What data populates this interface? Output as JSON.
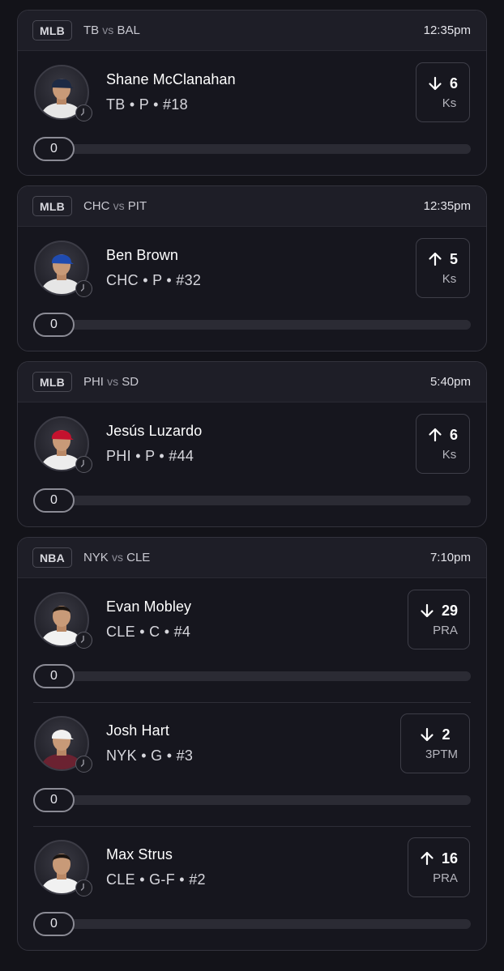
{
  "games": [
    {
      "league": "MLB",
      "home": "TB",
      "vs": "vs",
      "away": "BAL",
      "time": "12:35pm",
      "picks": [
        {
          "name": "Shane McClanahan",
          "meta": "TB • P • #18",
          "direction": "down",
          "line": "6",
          "stat": "Ks",
          "progress": "0",
          "cap_color": "#1d2a44",
          "jersey_color": "#e6e6e6"
        }
      ]
    },
    {
      "league": "MLB",
      "home": "CHC",
      "vs": "vs",
      "away": "PIT",
      "time": "12:35pm",
      "picks": [
        {
          "name": "Ben Brown",
          "meta": "CHC • P • #32",
          "direction": "up",
          "line": "5",
          "stat": "Ks",
          "progress": "0",
          "cap_color": "#1f4bb0",
          "jersey_color": "#e6e6e6"
        }
      ]
    },
    {
      "league": "MLB",
      "home": "PHI",
      "vs": "vs",
      "away": "SD",
      "time": "5:40pm",
      "picks": [
        {
          "name": "Jesús Luzardo",
          "meta": "PHI • P • #44",
          "direction": "up",
          "line": "6",
          "stat": "Ks",
          "progress": "0",
          "cap_color": "#c4122e",
          "jersey_color": "#ededed"
        }
      ]
    },
    {
      "league": "NBA",
      "home": "NYK",
      "vs": "vs",
      "away": "CLE",
      "time": "7:10pm",
      "picks": [
        {
          "name": "Evan Mobley",
          "meta": "CLE • C • #4",
          "direction": "down",
          "line": "29",
          "stat": "PRA",
          "progress": "0",
          "cap_color": "",
          "jersey_color": "#f1f1f1"
        },
        {
          "name": "Josh Hart",
          "meta": "NYK • G • #3",
          "direction": "down",
          "line": "2",
          "stat": "3PTM",
          "progress": "0",
          "cap_color": "#f1f1f1",
          "jersey_color": "#6b2231"
        },
        {
          "name": "Max Strus",
          "meta": "CLE • G-F • #2",
          "direction": "up",
          "line": "16",
          "stat": "PRA",
          "progress": "0",
          "cap_color": "",
          "jersey_color": "#f1f1f1"
        }
      ]
    }
  ]
}
